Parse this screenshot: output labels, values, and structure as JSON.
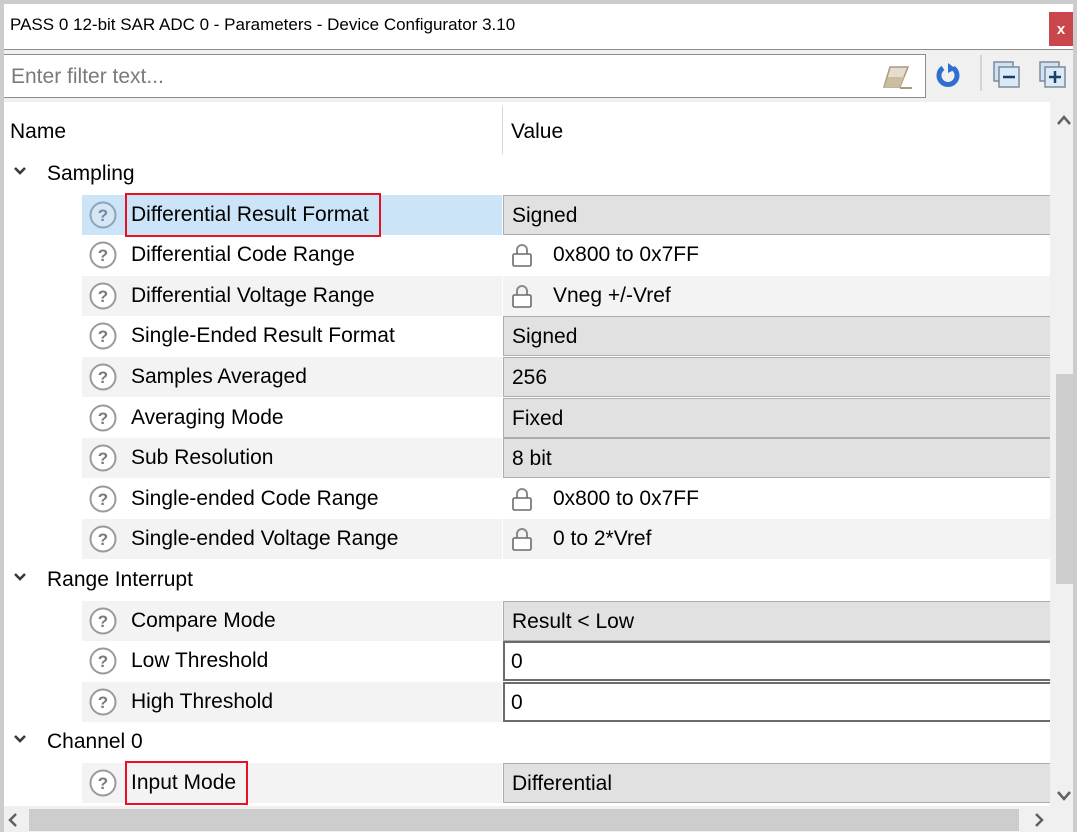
{
  "window": {
    "title": "PASS 0 12-bit SAR ADC 0 - Parameters - Device Configurator 3.10",
    "close_label": "x"
  },
  "toolbar": {
    "filter_placeholder": "Enter filter text...",
    "filter_value": "",
    "icons": [
      "eraser-icon",
      "refresh-icon",
      "collapse-all-icon",
      "expand-all-icon"
    ]
  },
  "colors": {
    "selection": "#cce4f7",
    "highlight_border": "#e81123",
    "close_button": "#c9474c",
    "refresh_blue": "#2f6fd0"
  },
  "grid": {
    "columns": {
      "name": "Name",
      "value": "Value"
    },
    "groups": [
      {
        "label": "Sampling",
        "expanded": true,
        "params": [
          {
            "name": "Differential Result Format",
            "value": "Signed",
            "kind": "combo",
            "selected": true,
            "highlighted": true
          },
          {
            "name": "Differential Code Range",
            "value": "0x800 to 0x7FF",
            "kind": "readonly"
          },
          {
            "name": "Differential Voltage Range",
            "value": "Vneg +/-Vref",
            "kind": "readonly"
          },
          {
            "name": "Single-Ended Result Format",
            "value": "Signed",
            "kind": "combo"
          },
          {
            "name": "Samples Averaged",
            "value": "256",
            "kind": "combo"
          },
          {
            "name": "Averaging Mode",
            "value": "Fixed",
            "kind": "combo"
          },
          {
            "name": "Sub Resolution",
            "value": "8 bit",
            "kind": "combo"
          },
          {
            "name": "Single-ended Code Range",
            "value": "0x800 to 0x7FF",
            "kind": "readonly"
          },
          {
            "name": "Single-ended Voltage Range",
            "value": "0 to 2*Vref",
            "kind": "readonly"
          }
        ]
      },
      {
        "label": "Range Interrupt",
        "expanded": true,
        "params": [
          {
            "name": "Compare Mode",
            "value": "Result < Low",
            "kind": "combo"
          },
          {
            "name": "Low Threshold",
            "value": "0",
            "kind": "text"
          },
          {
            "name": "High Threshold",
            "value": "0",
            "kind": "text"
          }
        ]
      },
      {
        "label": "Channel 0",
        "expanded": true,
        "params": [
          {
            "name": "Input Mode",
            "value": "Differential",
            "kind": "combo",
            "highlighted": true
          }
        ]
      }
    ]
  }
}
